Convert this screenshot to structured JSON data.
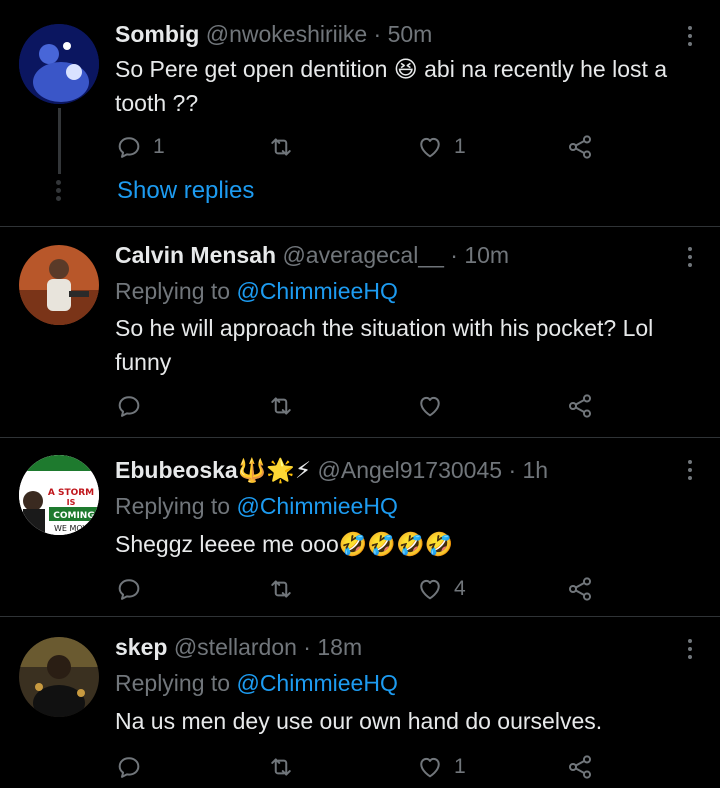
{
  "tweets": [
    {
      "name": "Sombig",
      "handle": "@nwokeshiriike",
      "dot": "·",
      "time": "50m",
      "text_before": "So Pere get open dentition ",
      "emoji": "😆",
      "text_after": " abi na recently he lost a tooth ??",
      "reply_count": "1",
      "retweet_count": "",
      "like_count": "1",
      "show_replies": "Show replies",
      "avatar_color": "#1a2a8a"
    },
    {
      "name": "Calvin Mensah",
      "handle": "@averagecal__",
      "dot": "·",
      "time": "10m",
      "replying_prefix": "Replying to",
      "replying_to": "@ChimmieeHQ",
      "text": "So he will approach the situation with his pocket? Lol funny",
      "reply_count": "",
      "retweet_count": "",
      "like_count": "",
      "avatar_color": "#c96a30"
    },
    {
      "name": "Ebubeoska",
      "name_emoji": "🔱🌟⚡",
      "handle": "@Angel91730045",
      "dot": "·",
      "time": "1h",
      "replying_prefix": "Replying to",
      "replying_to": "@ChimmieeHQ",
      "text": "Sheggz leeee me ooo",
      "text_emoji": "🤣🤣🤣🤣",
      "reply_count": "",
      "retweet_count": "",
      "like_count": "4",
      "avatar_text": [
        "A STORM",
        "IS",
        "COMING",
        "WE MOV"
      ],
      "avatar_color": "#ffffff"
    },
    {
      "name": "skep",
      "handle": "@stellardon",
      "dot": "·",
      "time": "18m",
      "replying_prefix": "Replying to",
      "replying_to": "@ChimmieeHQ",
      "text": "Na us men dey use our own hand do ourselves.",
      "reply_count": "",
      "retweet_count": "",
      "like_count": "1",
      "avatar_color": "#5a4a2a"
    }
  ],
  "colors": {
    "background": "#000000",
    "text": "#e7e9ea",
    "muted": "#71767b",
    "link": "#1d9bf0",
    "divider": "#2f3336"
  },
  "icons": [
    "reply-icon",
    "retweet-icon",
    "like-icon",
    "share-icon",
    "more-icon"
  ]
}
